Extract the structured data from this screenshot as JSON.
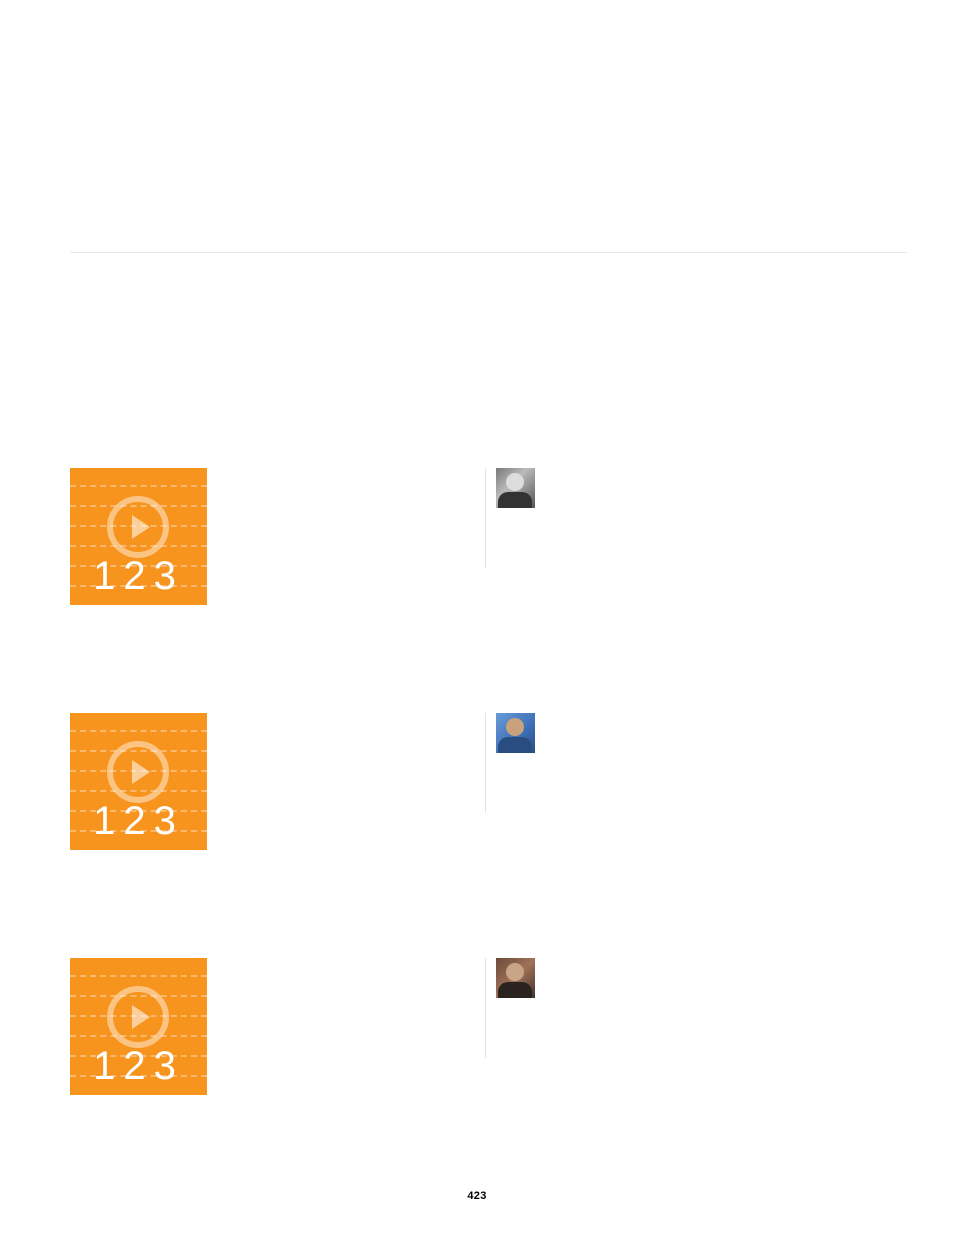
{
  "page_number": "423",
  "tiles": {
    "play_number": "123"
  },
  "items": [
    {
      "tile_number": "123"
    },
    {
      "tile_number": "123"
    },
    {
      "tile_number": "123"
    }
  ]
}
